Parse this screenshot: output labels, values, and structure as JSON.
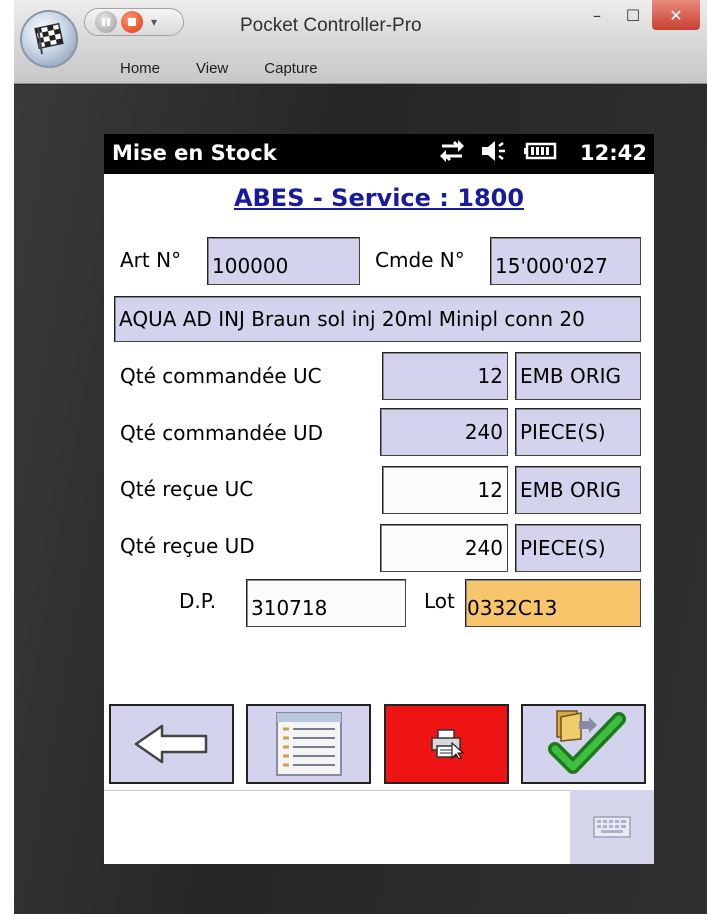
{
  "window": {
    "title": "Pocket Controller-Pro",
    "menu": [
      "Home",
      "View",
      "Capture"
    ],
    "controls": {
      "minimize": "–",
      "maximize": "☐",
      "close": "✕"
    }
  },
  "device": {
    "screen_title": "Mise en Stock",
    "time": "12:42",
    "status_icons": [
      "sync-icon",
      "volume-icon",
      "battery-icon"
    ]
  },
  "form": {
    "service_title": "ABES - Service : 1800",
    "art_label": "Art N°",
    "art_value": "100000",
    "cmde_label": "Cmde N°",
    "cmde_value": "15'000'027",
    "description": "AQUA AD INJ Braun sol inj 20ml Minipl conn 20",
    "rows": [
      {
        "label": "Qté commandée UC",
        "qty": "12",
        "unit": "EMB ORIG"
      },
      {
        "label": "Qté commandée UD",
        "qty": "240",
        "unit": "PIECE(S)"
      },
      {
        "label": "Qté reçue UC",
        "qty": "12",
        "unit": "EMB ORIG"
      },
      {
        "label": "Qté reçue UD",
        "qty": "240",
        "unit": "PIECE(S)"
      }
    ],
    "dp_label": "D.P.",
    "dp_value": "310718",
    "lot_label": "Lot",
    "lot_value": "0332C13"
  },
  "buttons": {
    "icons": [
      "back-arrow-icon",
      "list-icon",
      "print-icon",
      "validate-check-icon"
    ]
  },
  "colors": {
    "field_blue": "#d3d3ee",
    "field_orange": "#f7c66a",
    "print_red": "#ee1414",
    "title_blue": "#1a1a9c"
  }
}
